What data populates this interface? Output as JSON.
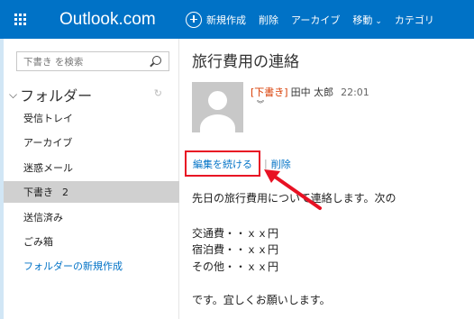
{
  "topbar": {
    "brand": "Outlook.com",
    "new_label": "新規作成",
    "delete_label": "削除",
    "archive_label": "アーカイブ",
    "move_label": "移動",
    "category_label": "カテゴリ"
  },
  "sidebar": {
    "search_placeholder": "下書き を検索",
    "folders_heading": "フォルダー",
    "items": [
      {
        "label": "受信トレイ"
      },
      {
        "label": "アーカイブ"
      },
      {
        "label": "迷惑メール"
      },
      {
        "label": "下書き",
        "count": "2"
      },
      {
        "label": "送信済み"
      },
      {
        "label": "ごみ箱"
      }
    ],
    "new_folder_label": "フォルダーの新規作成"
  },
  "message": {
    "subject": "旅行費用の連絡",
    "draft_tag": "[下書き]",
    "sender": "田中 太郎",
    "time": "22:01",
    "edit_label": "編集を続ける",
    "separator": "|",
    "delete_label": "削除",
    "body": [
      "先日の旅行費用について連絡します。次の",
      "交通費・・ｘｘ円",
      "宿泊費・・ｘｘ円",
      "その他・・ｘｘ円",
      "です。宜しくお願いします。"
    ]
  },
  "colors": {
    "brand_blue": "#0072c6",
    "draft_orange": "#d83b01",
    "highlight_red": "#e81123",
    "selected_gray": "#d0d0d0"
  }
}
